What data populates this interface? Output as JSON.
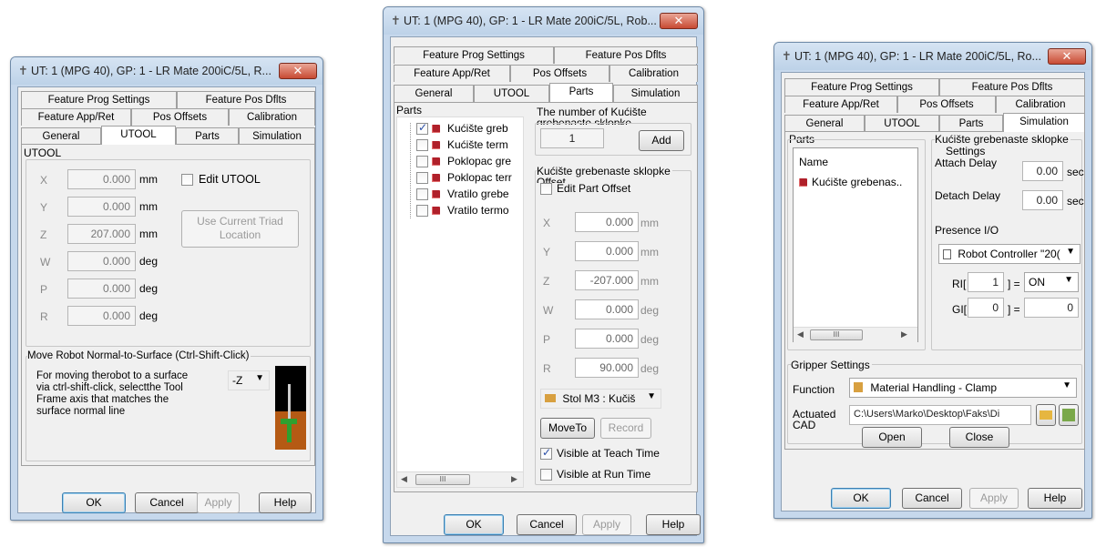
{
  "dialog1": {
    "title": "UT: 1  (MPG 40), GP: 1 - LR Mate 200iC/5L, R...",
    "close": "✕",
    "tabs_row1": [
      "Feature Prog Settings",
      "Feature Pos Dflts"
    ],
    "tabs_row2": [
      "Feature App/Ret",
      "Pos Offsets",
      "Calibration"
    ],
    "tabs_row3": [
      "General",
      "UTOOL",
      "Parts",
      "Simulation"
    ],
    "group_utool": "UTOOL",
    "rows": [
      {
        "axis": "X",
        "value": "0.000",
        "unit": "mm"
      },
      {
        "axis": "Y",
        "value": "0.000",
        "unit": "mm"
      },
      {
        "axis": "Z",
        "value": "207.000",
        "unit": "mm"
      },
      {
        "axis": "W",
        "value": "0.000",
        "unit": "deg"
      },
      {
        "axis": "P",
        "value": "0.000",
        "unit": "deg"
      },
      {
        "axis": "R",
        "value": "0.000",
        "unit": "deg"
      }
    ],
    "edit_utool": "Edit UTOOL",
    "use_triad_l1": "Use Current Triad",
    "use_triad_l2": "Location",
    "move_group": "Move Robot Normal-to-Surface (Ctrl-Shift-Click)",
    "move_desc_1": "For moving therobot to a surface",
    "move_desc_2": "via ctrl-shift-click, selectthe Tool",
    "move_desc_3": "Frame axis that matches the",
    "move_desc_4": "surface normal line",
    "axis_select": "-Z",
    "ok": "OK",
    "cancel": "Cancel",
    "apply": "Apply",
    "help": "Help"
  },
  "dialog2": {
    "title": "UT: 1  (MPG 40), GP: 1 - LR Mate 200iC/5L, Rob...",
    "close": "✕",
    "tabs_row1": [
      "Feature Prog Settings",
      "Feature Pos Dflts"
    ],
    "tabs_row2": [
      "Feature App/Ret",
      "Pos Offsets",
      "Calibration"
    ],
    "tabs_row3": [
      "General",
      "UTOOL",
      "Parts",
      "Simulation"
    ],
    "parts_group": "Parts",
    "parts": [
      {
        "name": "Kućište greb",
        "checked": true
      },
      {
        "name": "Kućište term",
        "checked": false
      },
      {
        "name": "Poklopac gre",
        "checked": false
      },
      {
        "name": "Poklopac terr",
        "checked": false
      },
      {
        "name": "Vratilo grebe",
        "checked": false
      },
      {
        "name": "Vratilo termo",
        "checked": false
      }
    ],
    "count_label_1": "The number of Kućište",
    "count_label_2": "grebenaste sklopke",
    "count_value": "1",
    "add": "Add",
    "offset_group_1": "Kućište grebenaste sklopke",
    "offset_group_2": "Offset",
    "edit_offset": "Edit Part Offset",
    "rows": [
      {
        "axis": "X",
        "value": "0.000",
        "unit": "mm"
      },
      {
        "axis": "Y",
        "value": "0.000",
        "unit": "mm"
      },
      {
        "axis": "Z",
        "value": "-207.000",
        "unit": "mm"
      },
      {
        "axis": "W",
        "value": "0.000",
        "unit": "deg"
      },
      {
        "axis": "P",
        "value": "0.000",
        "unit": "deg"
      },
      {
        "axis": "R",
        "value": "90.000",
        "unit": "deg"
      }
    ],
    "fixture_select": "Stol M3 : Kučiš",
    "moveto": "MoveTo",
    "record": "Record",
    "visible_teach": "Visible at Teach Time",
    "visible_teach_checked": true,
    "visible_run": "Visible at Run Time",
    "visible_run_checked": false,
    "scroll_thumb": "III",
    "ok": "OK",
    "cancel": "Cancel",
    "apply": "Apply",
    "help": "Help"
  },
  "dialog3": {
    "title": "UT: 1  (MPG 40), GP: 1 - LR Mate 200iC/5L, Ro...",
    "close": "✕",
    "tabs_row1": [
      "Feature Prog Settings",
      "Feature Pos Dflts"
    ],
    "tabs_row2": [
      "Feature App/Ret",
      "Pos Offsets",
      "Calibration"
    ],
    "tabs_row3": [
      "General",
      "UTOOL",
      "Parts",
      "Simulation"
    ],
    "parts_group": "Parts",
    "list_header": "Name",
    "list_item": "Kućište grebenas..",
    "settings_title_1": "Kućište grebenaste sklopke",
    "settings_title_2": "Settings",
    "attach_label": "Attach Delay",
    "attach_value": "0.00",
    "detach_label": "Detach Delay",
    "detach_value": "0.00",
    "sec": "sec",
    "presence_label": "Presence I/O",
    "controller_select": "Robot Controller \"20(",
    "ri_label": "RI[",
    "ri_value": "1",
    "ri_eq": "] =",
    "ri_state": "ON",
    "gi_label": "GI[",
    "gi_value": "0",
    "gi_eq": "] =",
    "gi_state": "0",
    "gripper_group": "Gripper Settings",
    "function_label": "Function",
    "function_value": "Material Handling - Clamp",
    "actuated_label_1": "Actuated",
    "actuated_label_2": "CAD",
    "cad_path": "C:\\Users\\Marko\\Desktop\\Faks\\Di",
    "open": "Open",
    "close_btn": "Close",
    "scroll_thumb": "III",
    "ok": "OK",
    "cancel": "Cancel",
    "apply": "Apply",
    "help": "Help"
  }
}
